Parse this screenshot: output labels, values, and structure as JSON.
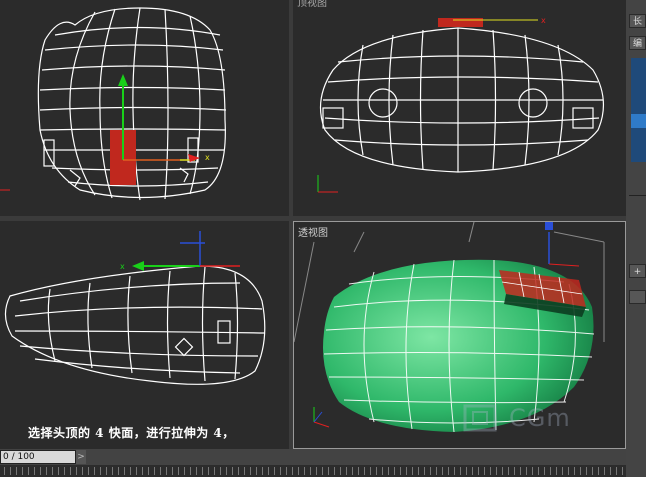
{
  "viewports": {
    "perspective_label": "透视图",
    "top_label": "顶视图"
  },
  "caption": "选择头顶的 4 快面，进行拉伸为 4，",
  "timeline": {
    "frame_display": "0 / 100",
    "next_label": ">"
  },
  "side_panel": {
    "btn1": "长",
    "btn2": "编",
    "btn3": "+"
  },
  "watermark": "CGm",
  "colors": {
    "viewport_bg": "#2b2b2b",
    "wire": "#ffffff",
    "mesh_green": "#2fb86a",
    "selection_red": "#c0281e",
    "gizmo_green": "#19d019",
    "gizmo_red": "#e02020",
    "gizmo_blue": "#2a4fd8"
  },
  "icons": [
    "move-gizmo-icon",
    "axis-tripod-icon",
    "vertical-bar-icon"
  ]
}
